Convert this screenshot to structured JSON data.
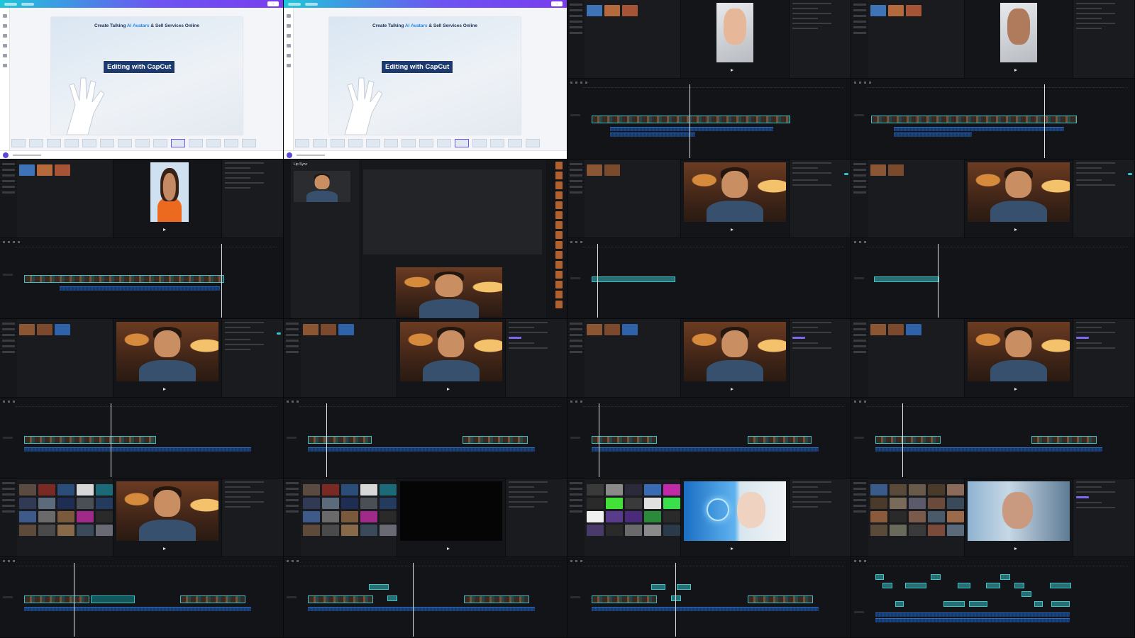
{
  "canva": {
    "headline_prefix": "Create Talking ",
    "headline_accent": "AI Avatars",
    "headline_suffix": " & Sell Services Online",
    "caption": "Editing with CapCut",
    "brand_gradient": [
      "#1ec6d8",
      "#6d55f2"
    ]
  },
  "lip_sync": {
    "title": "Lip Sync"
  },
  "colors": {
    "clip_teal": "#3bbec4",
    "audio_blue": "#2d6cc2",
    "playhead": "#dfe1e5",
    "generate_button": "#5ee45a"
  },
  "cells": [
    {
      "id": "canva-1",
      "type": "canva"
    },
    {
      "id": "canva-2",
      "type": "canva"
    },
    {
      "id": "editor-keyboard-1",
      "type": "editor",
      "scene": "keys"
    },
    {
      "id": "editor-keyboard-2",
      "type": "editor",
      "scene": "keys"
    },
    {
      "id": "editor-woman",
      "type": "editor",
      "scene": "woman"
    },
    {
      "id": "lip-sync",
      "type": "lip"
    },
    {
      "id": "editor-man-1",
      "type": "editor",
      "scene": "man"
    },
    {
      "id": "editor-man-2",
      "type": "editor",
      "scene": "man"
    },
    {
      "id": "editor-man-3",
      "type": "editor",
      "scene": "man"
    },
    {
      "id": "editor-man-4",
      "type": "editor",
      "scene": "man"
    },
    {
      "id": "editor-man-5",
      "type": "editor",
      "scene": "man"
    },
    {
      "id": "editor-man-6",
      "type": "editor",
      "scene": "man"
    },
    {
      "id": "editor-library-man",
      "type": "editor",
      "scene": "man"
    },
    {
      "id": "editor-library-black",
      "type": "editor",
      "scene": "black"
    },
    {
      "id": "editor-library-voice",
      "type": "editor",
      "scene": "voice"
    },
    {
      "id": "editor-library-window",
      "type": "editor",
      "scene": "window"
    }
  ]
}
